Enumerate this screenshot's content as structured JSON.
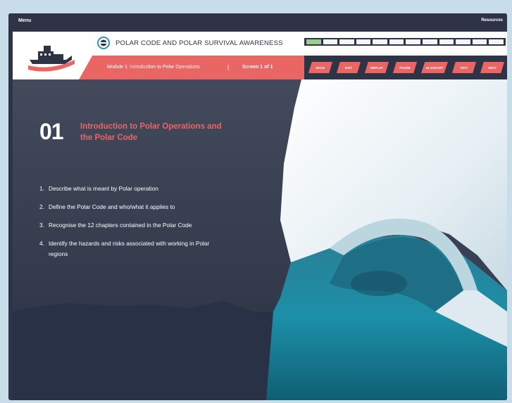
{
  "topbar": {
    "menu_label": "Menu",
    "resources_label": "Resources"
  },
  "header": {
    "course_title": "POLAR CODE AND POLAR SURVIVAL AWARENESS",
    "progress": {
      "total_segments": 12,
      "completed_segments": 1
    },
    "module_label": "Module 1: Introduction to Polar Operations",
    "separator": "|",
    "screen_label": "Screen 1 of 1"
  },
  "nav": {
    "buttons": [
      "BACK",
      "EXIT",
      "REPLAY",
      "PAUSE",
      "GLOSSARY",
      "TEXT",
      "NEXT"
    ]
  },
  "content": {
    "number": "01",
    "heading": "Introduction to Polar Operations and the Polar Code",
    "objectives": [
      {
        "num": "1.",
        "text": "Describe what is meant by Polar operation"
      },
      {
        "num": "2.",
        "text": "Define the Polar Code and who/what it applies to"
      },
      {
        "num": "3.",
        "text": "Recognise the 12 chapters contained in the Polar Code"
      },
      {
        "num": "4.",
        "text": "Identify the hazards and risks associated with working in Polar regions"
      }
    ]
  },
  "colors": {
    "accent": "#ea6664",
    "navy": "#2e3446",
    "progress_done": "#9ccf8d",
    "ice_water": "#1f8aa3"
  }
}
